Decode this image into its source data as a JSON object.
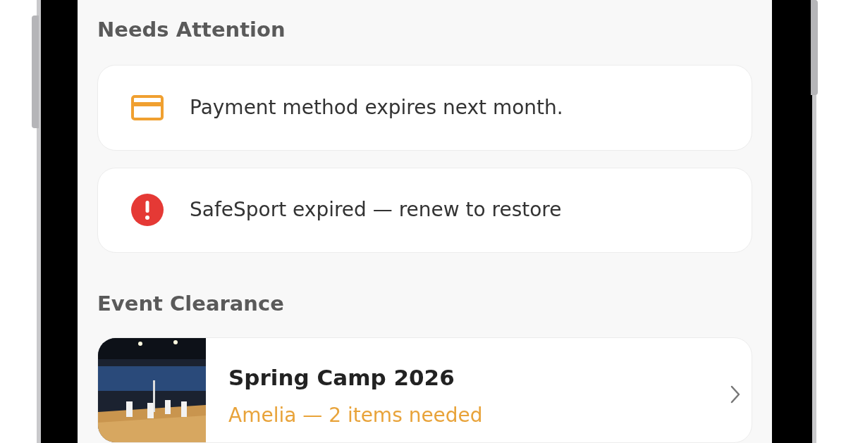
{
  "sections": [
    {
      "heading": "Needs Attention",
      "alerts": [
        {
          "kind": "card",
          "text": "Payment method expires next month."
        },
        {
          "kind": "error",
          "text": "SafeSport expired — renew to restore"
        }
      ]
    },
    {
      "heading": "Event Clearance",
      "events": [
        {
          "title": "Spring Camp 2026",
          "subtitle": "Amelia — 2 items needed"
        }
      ]
    }
  ]
}
